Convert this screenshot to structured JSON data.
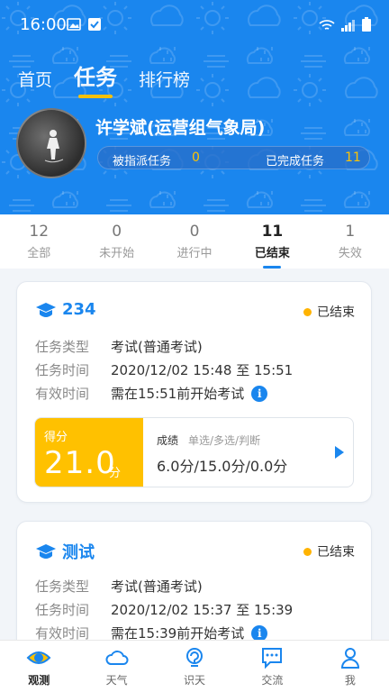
{
  "status_bar": {
    "time": "16:00"
  },
  "top_tabs": [
    {
      "label": "首页",
      "active": false
    },
    {
      "label": "任务",
      "active": true
    },
    {
      "label": "排行榜",
      "active": false
    }
  ],
  "user": {
    "name": "许学斌(运营组气象局)",
    "assigned_label": "被指派任务",
    "assigned_count": "0",
    "completed_label": "已完成任务",
    "completed_count": "11"
  },
  "filter_tabs": [
    {
      "count": "12",
      "label": "全部",
      "active": false
    },
    {
      "count": "0",
      "label": "未开始",
      "active": false
    },
    {
      "count": "0",
      "label": "进行中",
      "active": false
    },
    {
      "count": "11",
      "label": "已结束",
      "active": true
    },
    {
      "count": "1",
      "label": "失效",
      "active": false
    }
  ],
  "tasks": [
    {
      "title": "234",
      "status": "已结束",
      "type_label": "任务类型",
      "type_value": "考试(普通考试)",
      "time_label": "任务时间",
      "time_value": "2020/12/02 15:48 至 15:51",
      "valid_label": "有效时间",
      "valid_value": "需在15:51前开始考试",
      "score_tag": "得分",
      "score": "21.0",
      "score_unit": "分",
      "result_label": "成绩",
      "result_hint": "单选/多选/判断",
      "result_value": "6.0分/15.0分/0.0分"
    },
    {
      "title": "测试",
      "status": "已结束",
      "type_label": "任务类型",
      "type_value": "考试(普通考试)",
      "time_label": "任务时间",
      "time_value": "2020/12/02 15:37 至 15:39",
      "valid_label": "有效时间",
      "valid_value": "需在15:39前开始考试"
    }
  ],
  "bottom_nav": [
    {
      "label": "观测",
      "icon": "eye-icon",
      "active": true
    },
    {
      "label": "天气",
      "icon": "cloud-icon",
      "active": false
    },
    {
      "label": "识天",
      "icon": "identify-icon",
      "active": false
    },
    {
      "label": "交流",
      "icon": "chat-icon",
      "active": false
    },
    {
      "label": "我",
      "icon": "person-icon",
      "active": false
    }
  ],
  "colors": {
    "primary": "#1a86ee",
    "accent": "#ffc100",
    "status_dot": "#ffb300"
  }
}
